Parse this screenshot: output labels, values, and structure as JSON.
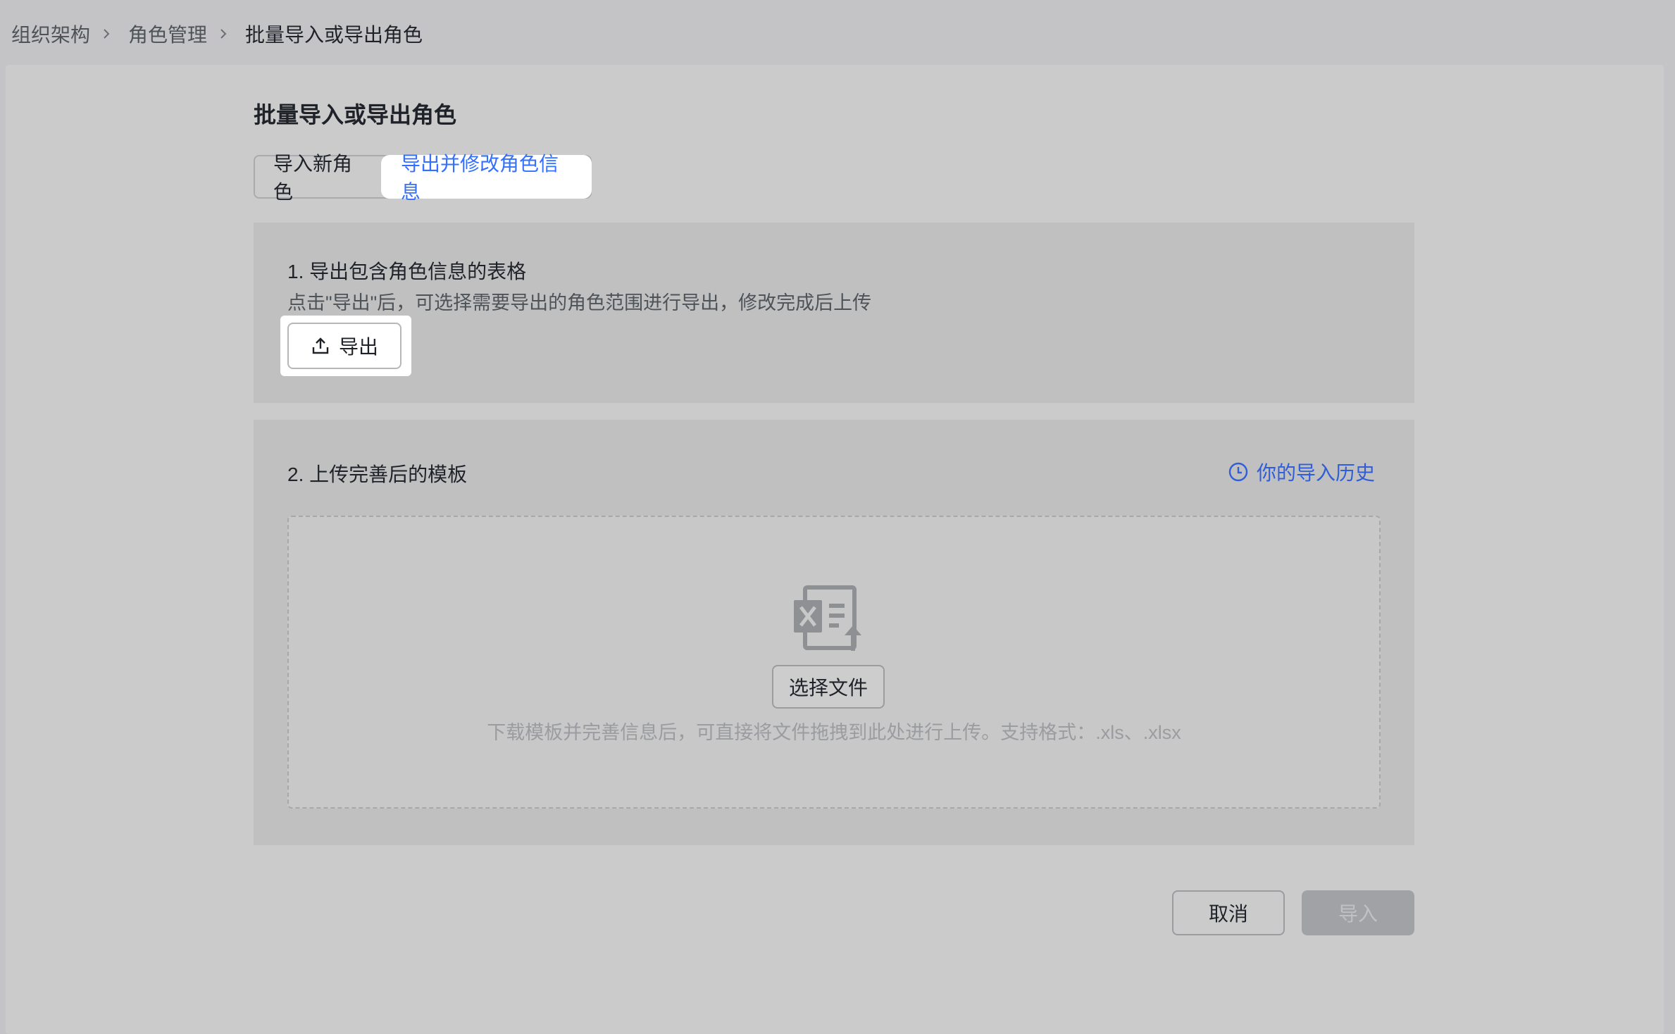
{
  "breadcrumb": {
    "items": [
      "组织架构",
      "角色管理"
    ],
    "current": "批量导入或导出角色"
  },
  "page": {
    "title": "批量导入或导出角色"
  },
  "tabs": [
    {
      "label": "导入新角色",
      "active": false
    },
    {
      "label": "导出并修改角色信息",
      "active": true
    }
  ],
  "step1": {
    "title": "1. 导出包含角色信息的表格",
    "description": "点击\"导出\"后，可选择需要导出的角色范围进行导出，修改完成后上传",
    "export_label": "导出",
    "export_icon": "upload-icon"
  },
  "step2": {
    "title": "2. 上传完善后的模板",
    "history_label": "你的导入历史",
    "history_icon": "clock-icon",
    "file_icon": "excel-upload-icon",
    "choose_file_label": "选择文件",
    "hint": "下载模板并完善信息后，可直接将文件拖拽到此处进行上传。支持格式：.xls、.xlsx"
  },
  "footer": {
    "cancel_label": "取消",
    "import_label": "导入",
    "import_disabled": true
  },
  "colors": {
    "accent": "#3370ff",
    "link": "#2f5ed8",
    "overlay_bg": "#c4c4c6"
  }
}
